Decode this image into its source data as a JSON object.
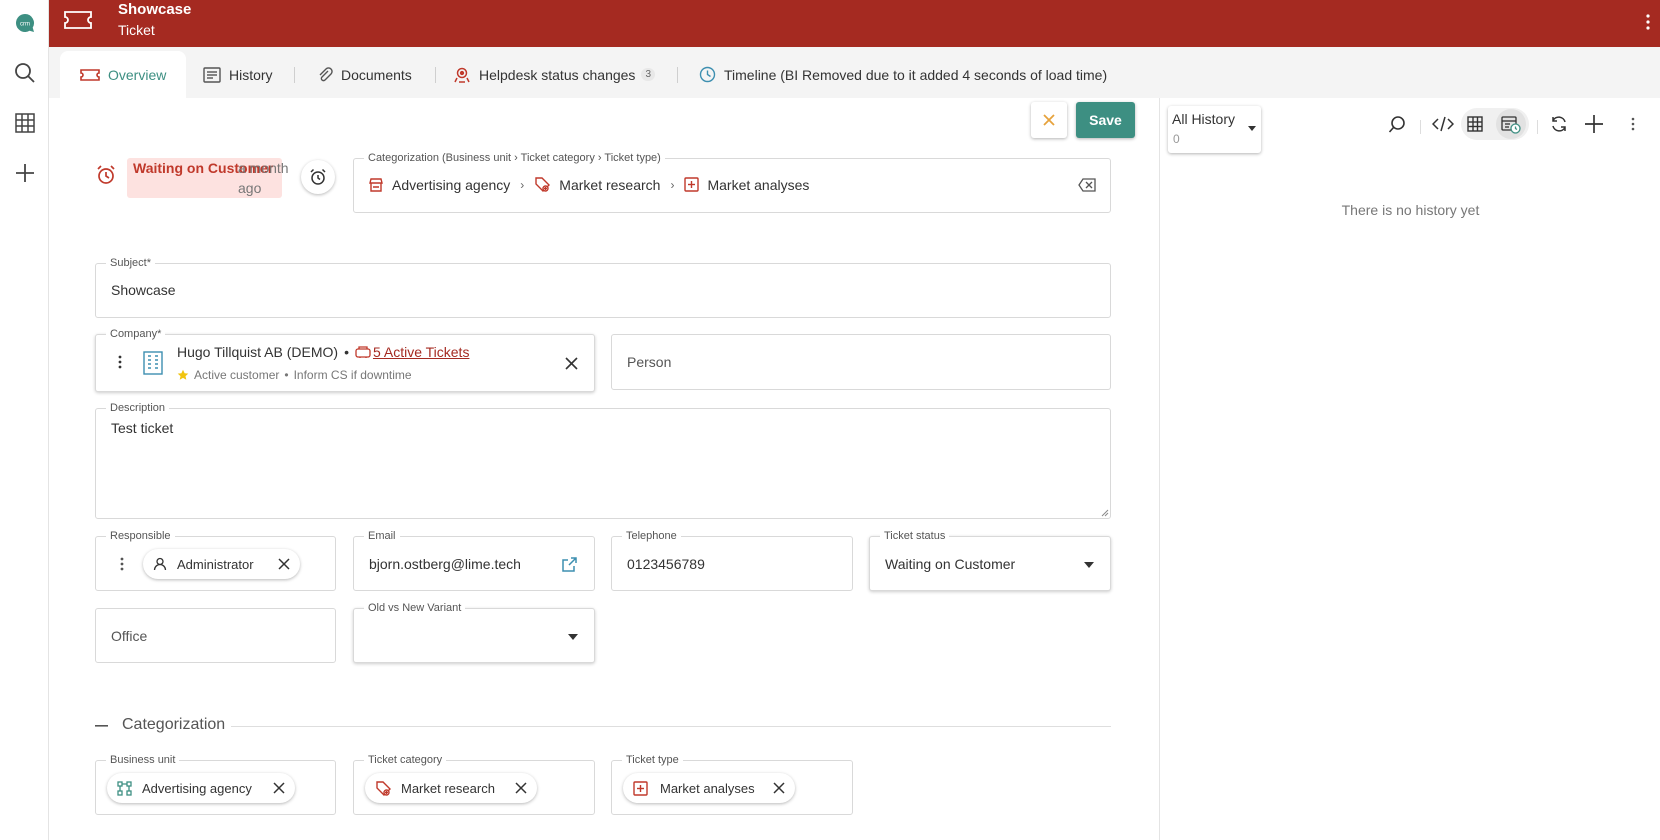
{
  "header": {
    "title": "Showcase",
    "subtitle": "Ticket"
  },
  "tabs": [
    {
      "label": "Overview"
    },
    {
      "label": "History"
    },
    {
      "label": "Documents"
    },
    {
      "label": "Helpdesk status changes",
      "badge": "3"
    },
    {
      "label": "Timeline (BI Removed due to it added 4 seconds of load time)"
    }
  ],
  "actions": {
    "save_label": "Save"
  },
  "status": {
    "label": "Waiting on Customer",
    "time": "a month ago"
  },
  "categorization_path": {
    "label": "Categorization (Business unit › Ticket category › Ticket type)",
    "items": [
      "Advertising agency",
      "Market research",
      "Market analyses"
    ]
  },
  "subject": {
    "label": "Subject*",
    "value": "Showcase"
  },
  "company": {
    "label": "Company*",
    "name": "Hugo Tillquist AB (DEMO)",
    "separator": "•",
    "tickets_link": "5 Active Tickets",
    "meta1": "Active customer",
    "meta_sep": "•",
    "meta2": "Inform CS if downtime"
  },
  "person": {
    "placeholder": "Person"
  },
  "description": {
    "label": "Description",
    "value": "Test ticket"
  },
  "responsible": {
    "label": "Responsible",
    "value": "Administrator"
  },
  "email": {
    "label": "Email",
    "value": "bjorn.ostberg@lime.tech"
  },
  "telephone": {
    "label": "Telephone",
    "value": "0123456789"
  },
  "ticket_status": {
    "label": "Ticket status",
    "value": "Waiting on Customer"
  },
  "office": {
    "placeholder": "Office"
  },
  "variant": {
    "label": "Old vs New Variant",
    "value": ""
  },
  "categorization_section": {
    "title": "Categorization"
  },
  "business_unit": {
    "label": "Business unit",
    "value": "Advertising agency"
  },
  "ticket_category": {
    "label": "Ticket category",
    "value": "Market research"
  },
  "ticket_type": {
    "label": "Ticket type",
    "value": "Market analyses"
  },
  "history": {
    "filter_label": "All History",
    "count": "0",
    "empty_text": "There is no history yet"
  },
  "colors": {
    "brand": "#a52a21",
    "accent": "#3d8f82",
    "status_bg": "#fde2e0",
    "link": "#c0392b"
  },
  "icons": [
    "app-logo-icon",
    "search-icon",
    "grid-icon",
    "plus-icon",
    "ticket-icon",
    "more-vertical-icon",
    "history-list-icon",
    "paperclip-icon",
    "helpdesk-icon",
    "clock-icon",
    "alarm-icon",
    "snooze-icon",
    "store-icon",
    "tag-icon",
    "square-plus-icon",
    "backspace-icon",
    "building-icon",
    "star-icon",
    "person-icon",
    "external-link-icon",
    "chevron-down-icon",
    "sitemap-icon",
    "code-icon",
    "table-icon",
    "calendar-history-icon",
    "refresh-icon"
  ]
}
